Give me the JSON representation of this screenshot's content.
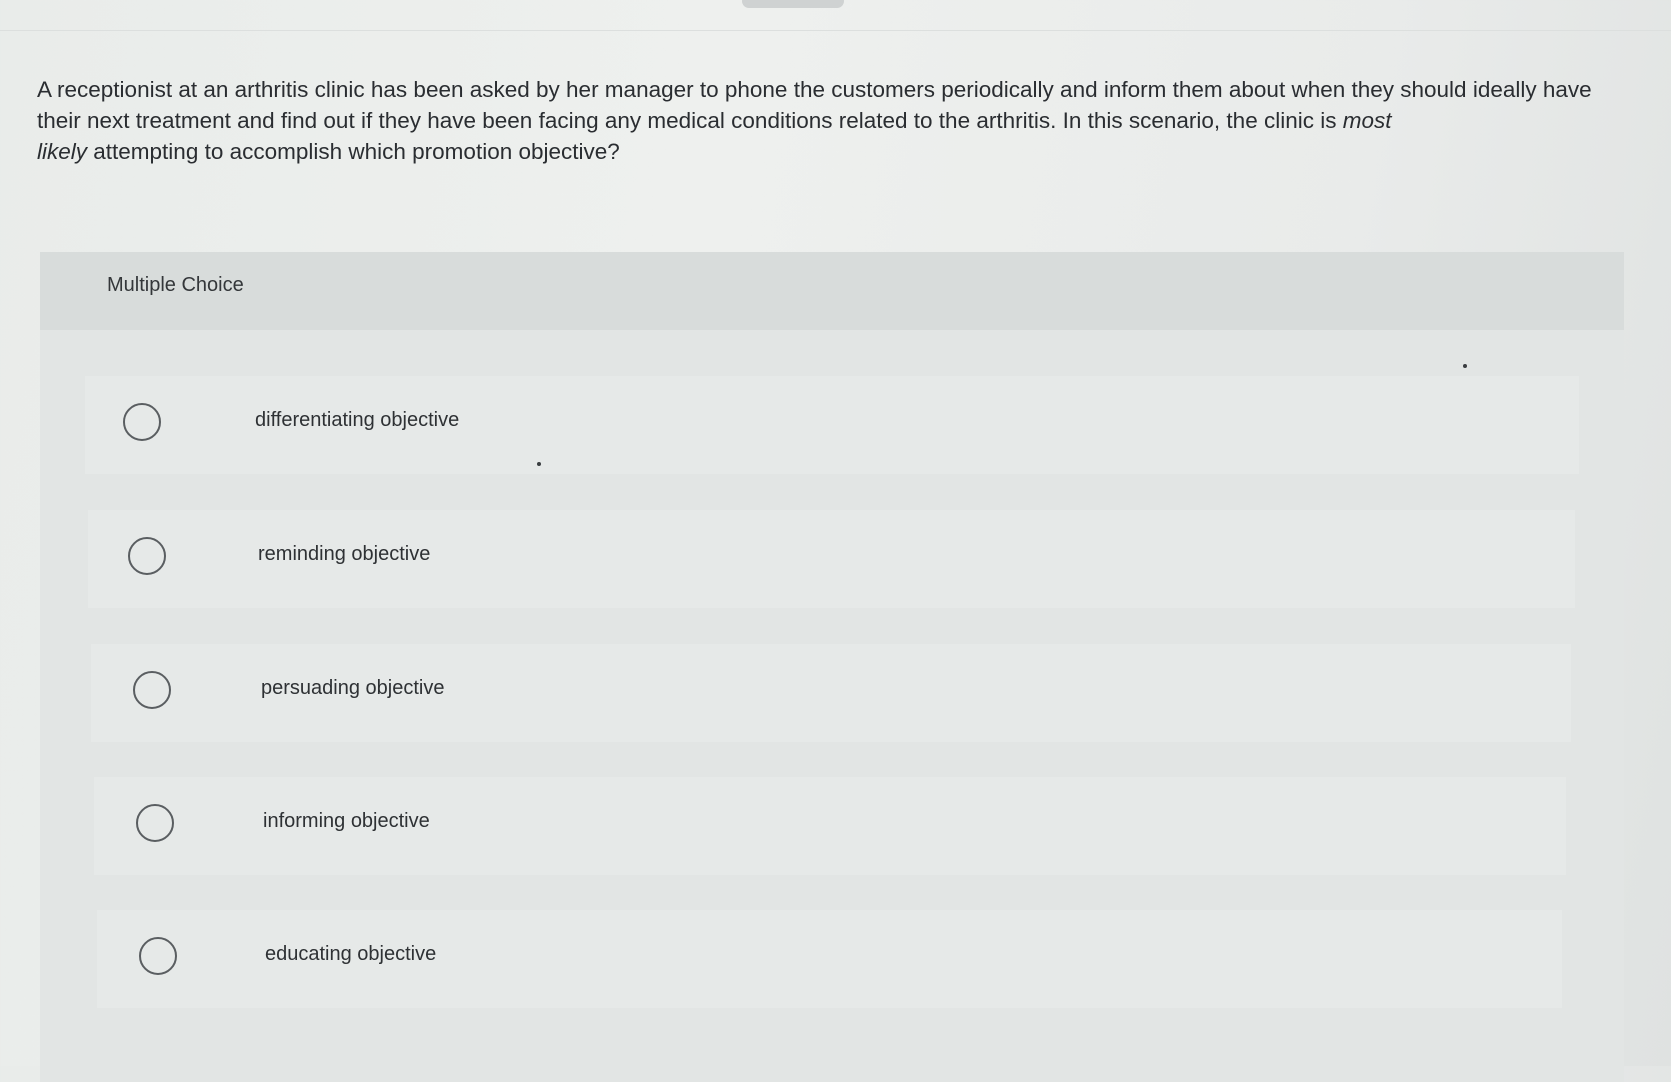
{
  "question": {
    "text_before_most": "A receptionist at an arthritis clinic has been asked by her manager to phone the customers periodically and inform them about when they should ideally have their next treatment and find out if they have been facing any medical conditions related to the arthritis. In this scenario, the clinic is ",
    "emphasis_most": "most",
    "emphasis_likely": "likely",
    "text_after": " attempting to accomplish which promotion objective?"
  },
  "multiple_choice": {
    "label": "Multiple Choice",
    "options": [
      {
        "label": "differentiating objective",
        "selected": false
      },
      {
        "label": "reminding objective",
        "selected": false
      },
      {
        "label": "persuading objective",
        "selected": false
      },
      {
        "label": "informing objective",
        "selected": false
      },
      {
        "label": "educating objective",
        "selected": false
      }
    ]
  }
}
